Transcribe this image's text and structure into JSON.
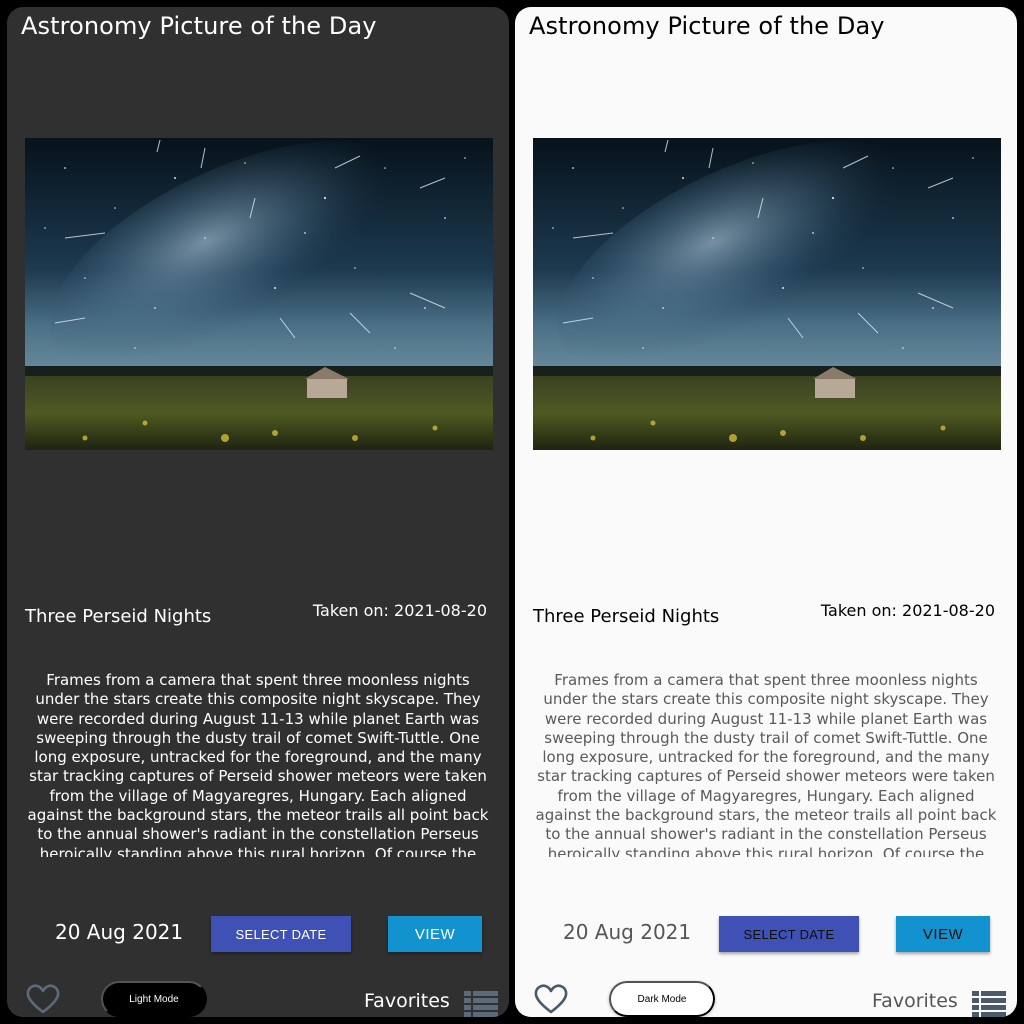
{
  "panels": [
    {
      "theme": "dark",
      "app_title": "Astronomy Picture of the Day",
      "picture_title": "Three Perseid Nights",
      "taken_on": "Taken on: 2021-08-20",
      "description": "Frames from a camera that spent three moonless nights under the stars create this composite night skyscape. They were recorded during August 11-13 while planet Earth was sweeping through the dusty trail of comet Swift-Tuttle. One long exposure, untracked for the foreground, and the many star tracking captures of Perseid shower meteors were taken from the village of Magyaregres, Hungary. Each aligned against the background stars, the meteor trails all point back to the annual shower's radiant in the constellation Perseus heroically standing above this rural horizon. Of course the comet dust",
      "date_display": "20 Aug 2021",
      "select_date_label": "SELECT DATE",
      "view_label": "VIEW",
      "mode_toggle_label": "Light Mode",
      "favorites_label": "Favorites",
      "icons": {
        "favorite": "heart-outline-icon",
        "list": "list-icon"
      }
    },
    {
      "theme": "light",
      "app_title": "Astronomy Picture of the Day",
      "picture_title": "Three Perseid Nights",
      "taken_on": "Taken on: 2021-08-20",
      "description": "Frames from a camera that spent three moonless nights under the stars create this composite night skyscape. They were recorded during August 11-13 while planet Earth was sweeping through the dusty trail of comet Swift-Tuttle. One long exposure, untracked for the foreground, and the many star tracking captures of Perseid shower meteors were taken from the village of Magyaregres, Hungary. Each aligned against the background stars, the meteor trails all point back to the annual shower's radiant in the constellation Perseus heroically standing above this rural horizon. Of course the comet dust",
      "date_display": "20 Aug 2021",
      "select_date_label": "SELECT DATE",
      "view_label": "VIEW",
      "mode_toggle_label": "Dark Mode",
      "favorites_label": "Favorites",
      "icons": {
        "favorite": "heart-outline-icon",
        "list": "list-icon"
      }
    }
  ],
  "colors": {
    "dark_background": "#303030",
    "light_background": "#fafafa",
    "select_date_button": "#3f51b5",
    "view_button": "#1293d0",
    "icon_dark_theme": "#5c6a7a",
    "icon_light_theme": "#4a5a6c"
  }
}
